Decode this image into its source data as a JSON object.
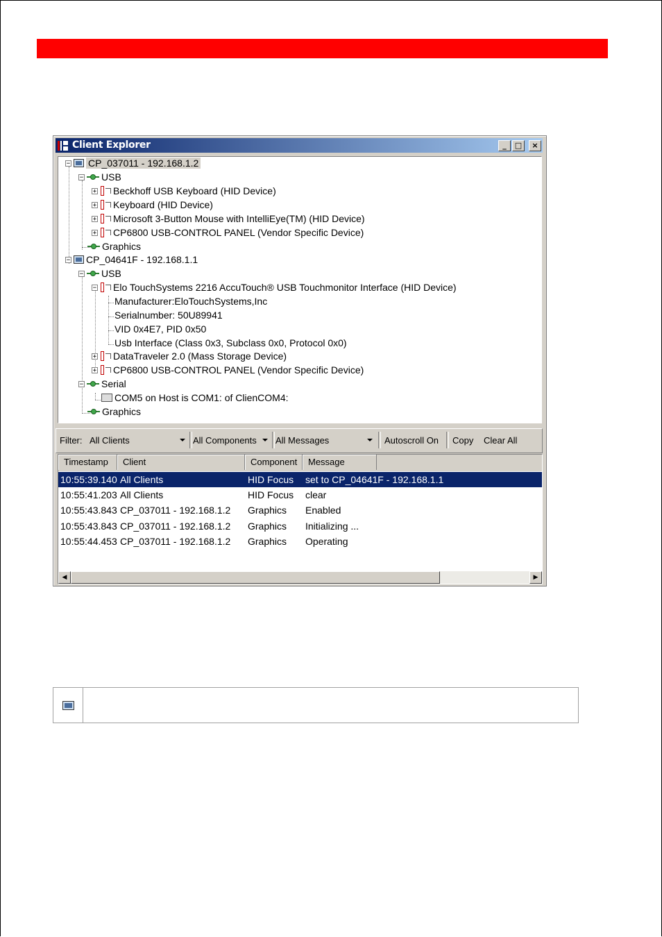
{
  "window": {
    "title": "Client Explorer",
    "buttons": {
      "minimize": "_",
      "maximize": "□",
      "close": "×"
    }
  },
  "tree": {
    "client1": {
      "label": "CP_037011 - 192.168.1.2",
      "usb": "USB",
      "devices": [
        "Beckhoff USB Keyboard (HID Device)",
        "Keyboard (HID Device)",
        "Microsoft 3-Button Mouse with IntelliEye(TM) (HID Device)",
        "CP6800 USB-CONTROL PANEL (Vendor Specific Device)"
      ],
      "graphics": "Graphics"
    },
    "client2": {
      "label": "CP_04641F - 192.168.1.1",
      "usb": "USB",
      "elo": "Elo TouchSystems 2216 AccuTouch® USB Touchmonitor Interface (HID Device)",
      "elo_details": [
        "Manufacturer:EloTouchSystems,Inc",
        "Serialnumber: 50U89941",
        "VID 0x4E7, PID 0x50",
        "Usb Interface (Class 0x3, Subclass 0x0, Protocol 0x0)"
      ],
      "datatraveler": "DataTraveler 2.0 (Mass Storage Device)",
      "cp6800": "CP6800 USB-CONTROL PANEL (Vendor Specific Device)",
      "serial": "Serial",
      "com": "COM5 on Host is COM1: of ClienCOM4:",
      "graphics": "Graphics"
    }
  },
  "toolbar": {
    "filter_label": "Filter:",
    "clients_value": "All Clients",
    "components_value": "All Components",
    "messages_value": "All Messages",
    "autoscroll": "Autoscroll On",
    "copy": "Copy",
    "clear_all": "Clear All"
  },
  "log": {
    "columns": [
      "Timestamp",
      "Client",
      "Component",
      "Message"
    ],
    "rows": [
      [
        "10:55:39.140",
        "All Clients",
        "HID Focus",
        "set to CP_04641F - 192.168.1.1"
      ],
      [
        "10:55:41.203",
        "All Clients",
        "HID Focus",
        "clear"
      ],
      [
        "10:55:43.843",
        "CP_037011 - 192.168.1.2",
        "Graphics",
        "Enabled"
      ],
      [
        "10:55:43.843",
        "CP_037011 - 192.168.1.2",
        "Graphics",
        "Initializing ..."
      ],
      [
        "10:55:44.453",
        "CP_037011 - 192.168.1.2",
        "Graphics",
        "Operating"
      ]
    ],
    "selected_row": 0
  },
  "colors": {
    "red_band": "#ff0000",
    "selection": "#0a246a",
    "titlebar_start": "#0a246a",
    "titlebar_end": "#a6caf0"
  }
}
